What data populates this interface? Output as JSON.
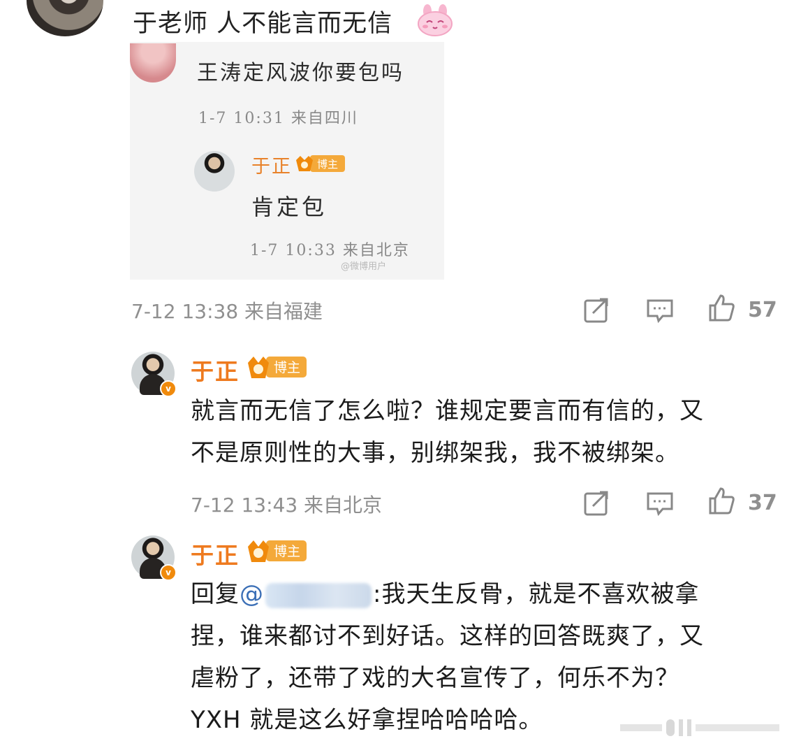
{
  "top_comment": {
    "text": "于老师 人不能言而无信",
    "emoji_icon": "bunny-face-icon"
  },
  "embedded": {
    "question": "王涛定风波你要包吗",
    "question_meta": "1-7 10:31 来自四川",
    "reply_name": "于正",
    "reply_badge": "博主",
    "reply_text": "肯定包",
    "reply_meta": "1-7 10:33 来自北京",
    "watermark": "@微博用户"
  },
  "comment_meta": {
    "time": "7-12 13:38 来自福建",
    "likes": "57"
  },
  "reply1": {
    "name": "于正",
    "badge": "博主",
    "line1": "就言而无信了怎么啦？谁规定要言而有信的，又",
    "line2": "不是原则性的大事，别绑架我，我不被绑架。",
    "time": "7-12 13:43 来自北京",
    "likes": "37"
  },
  "reply2": {
    "name": "于正",
    "badge": "博主",
    "prefix": "回复",
    "mention": "@",
    "line1_rest": ":我天生反骨，就是不喜欢被拿",
    "line2": "捏，谁来都讨不到好话。这样的回答既爽了，又",
    "line3": "虐粉了，还带了戏的大名宣传了，何乐不为？",
    "line4": "YXH 就是这么好拿捏哈哈哈哈。"
  },
  "colors": {
    "name": "#ee7a1f",
    "meta": "#8f8f8f",
    "badge": "#f0a02a",
    "verified": "#f08a0c"
  }
}
